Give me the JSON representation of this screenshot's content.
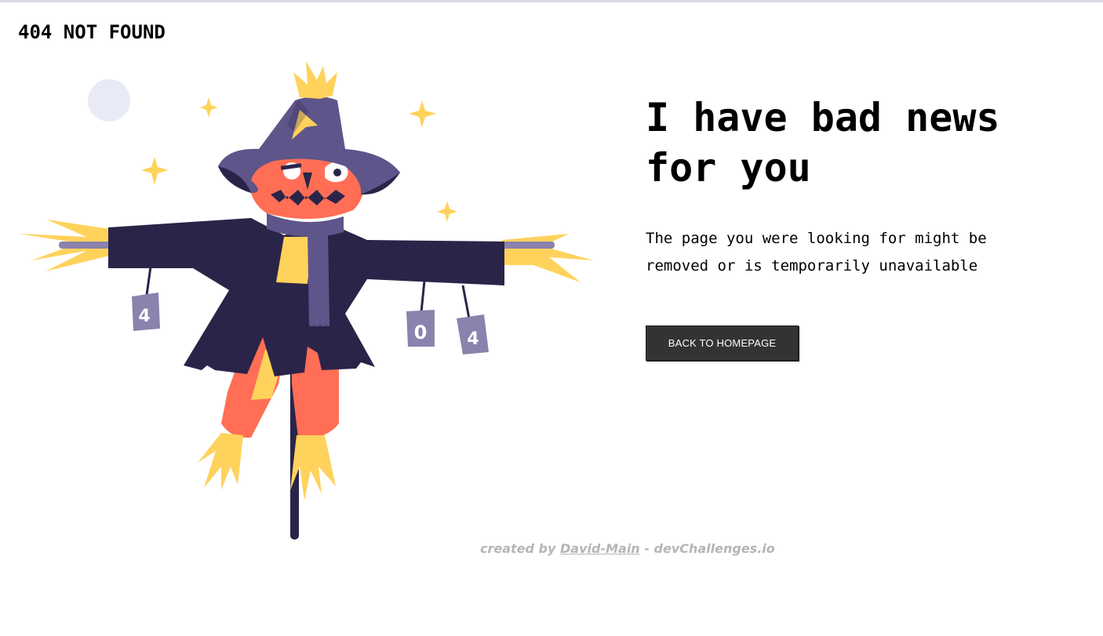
{
  "header": {
    "brand": "404 NOT FOUND"
  },
  "illustration": {
    "can_labels": [
      "4",
      "0",
      "4"
    ]
  },
  "main": {
    "headline": "I have bad news for you",
    "message": "The page you were looking for might be removed or is temporarily unavailable",
    "button_label": "BACK TO HOMEPAGE"
  },
  "footer": {
    "prefix": "created by",
    "author": "David-Main",
    "separator": "-",
    "site": "devChallenges.io"
  },
  "colors": {
    "hat": "#5e558a",
    "coat": "#2b2449",
    "face": "#ff6e55",
    "straw": "#ffd25c",
    "can": "#8b82ad",
    "button": "#333333"
  },
  "icons": [
    "moon-icon",
    "sparkle-icon"
  ]
}
